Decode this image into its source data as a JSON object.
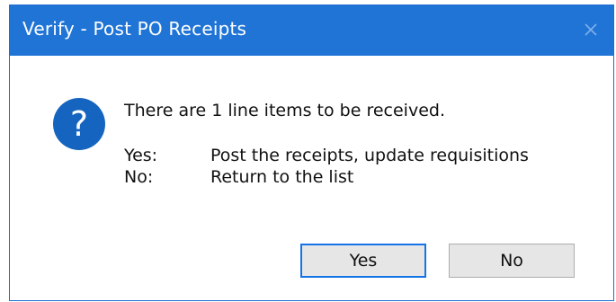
{
  "window": {
    "title": "Verify - Post PO Receipts",
    "close_icon": "close-icon"
  },
  "dialog": {
    "icon": "question-icon",
    "icon_glyph": "?",
    "message": "There are 1 line items to be received.",
    "options": [
      {
        "key": "Yes:",
        "description": "Post the receipts, update requisitions"
      },
      {
        "key": "No:",
        "description": "Return to the list"
      }
    ]
  },
  "buttons": {
    "yes_label": "Yes",
    "no_label": "No"
  },
  "colors": {
    "titlebar": "#1f74d6",
    "icon_bg": "#1565c0",
    "default_button_border": "#1473e6"
  }
}
